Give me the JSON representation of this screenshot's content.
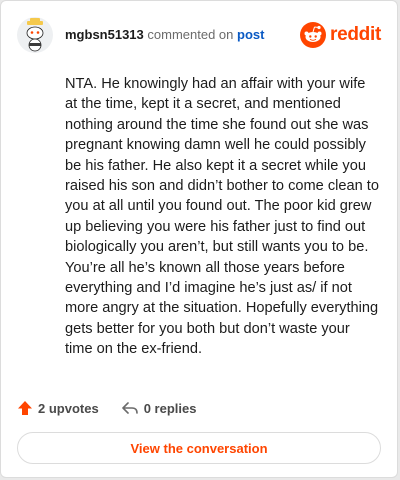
{
  "header": {
    "username": "mgbsn51313",
    "action_text": "commented on",
    "target_link": "post",
    "brand_wordmark": "reddit"
  },
  "comment": {
    "text": "NTA. He knowingly had an affair with your wife at the time, kept it a secret, and mentioned nothing around the time she found out she was pregnant knowing damn well he could possibly be his father. He also kept it a secret while you raised his son and didn’t bother to come clean to you at all until you found out. The poor kid grew up believing you were his father just to find out biologically you aren’t, but still wants you to be. You’re all he’s known all those years before everything and I’d imagine he’s just as/ if not more angry at the situation. Hopefully everything gets better for you both but don’t waste your time on the ex-friend."
  },
  "footer": {
    "upvotes_label": "2 upvotes",
    "replies_label": "0 replies",
    "view_button_label": "View the conversation"
  },
  "colors": {
    "brand": "#ff4500",
    "link": "#0a5ac4"
  },
  "icons": {
    "avatar": "snoo-avatar-icon",
    "logo": "reddit-logo-icon",
    "upvote": "upvote-arrow-icon",
    "reply": "reply-arrow-icon"
  }
}
